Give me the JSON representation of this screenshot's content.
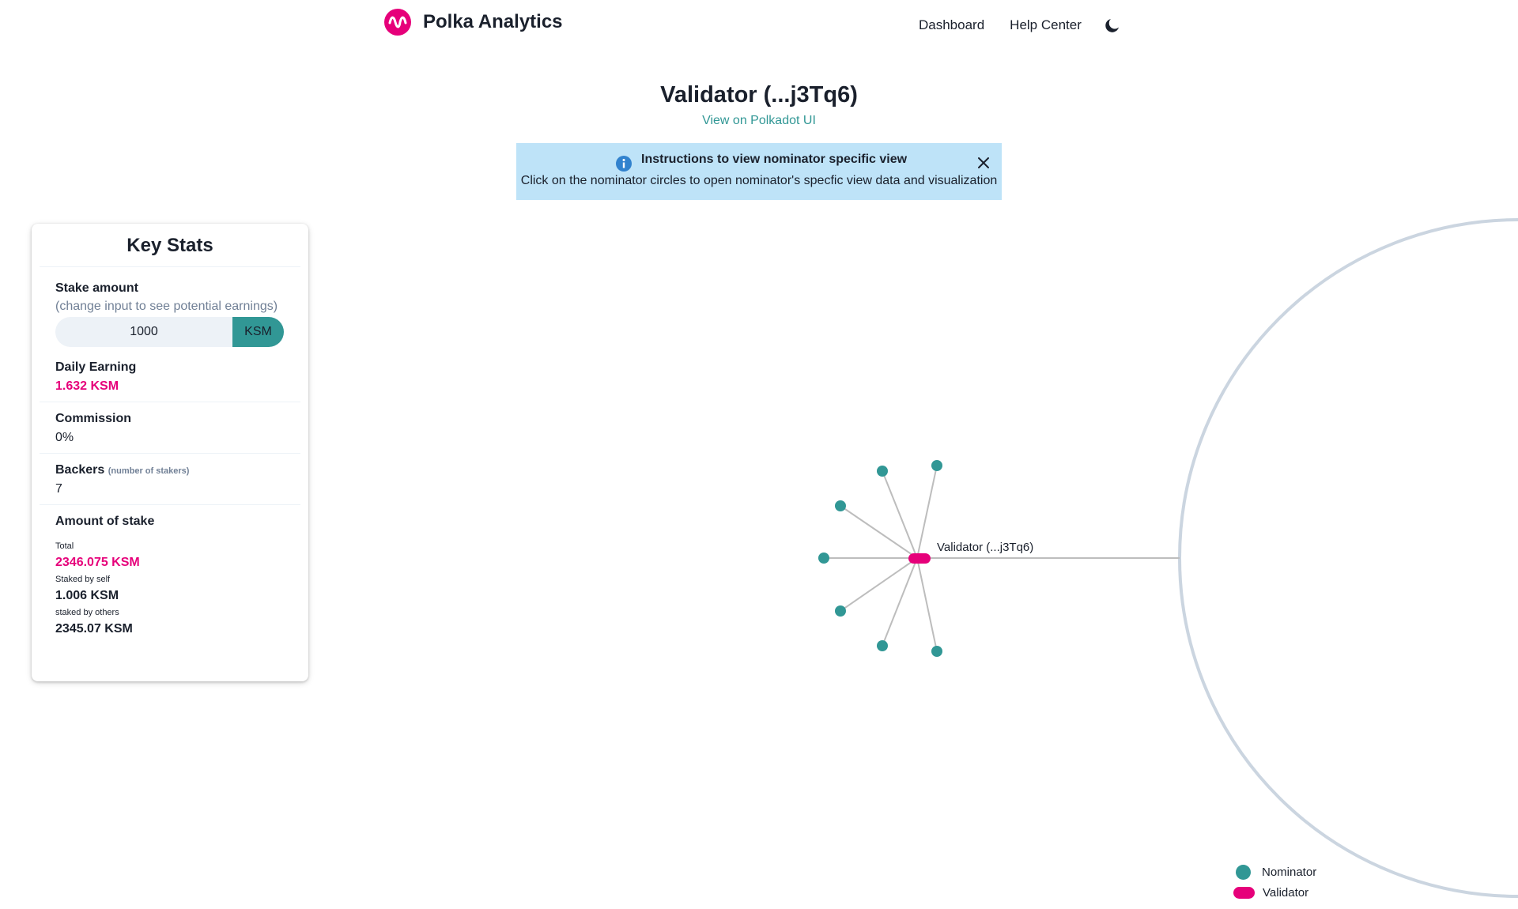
{
  "header": {
    "brand": "Polka Analytics",
    "nav": [
      "Dashboard",
      "Help Center"
    ],
    "theme_icon": "moon-icon"
  },
  "page": {
    "title": "Validator (...j3Tq6)",
    "link": "View on Polkadot UI"
  },
  "alert": {
    "title": "Instructions to view nominator specific view",
    "description": "Click on the nominator circles to open nominator's specfic view data and visualization",
    "icon": "info-icon",
    "color": "#bee3f8"
  },
  "key_stats": {
    "title": "Key Stats",
    "stake_amount": {
      "label": "Stake amount",
      "hint": "(change input to see potential earnings)",
      "value": "1000",
      "unit": "KSM"
    },
    "daily_earning": {
      "label": "Daily Earning",
      "value": "1.632 KSM"
    },
    "commission": {
      "label": "Commission",
      "value": "0%"
    },
    "backers": {
      "label": "Backers",
      "hint": "(number of stakers)",
      "value": "7"
    },
    "amount_of_stake": {
      "label": "Amount of stake",
      "total_label": "Total",
      "total_value": "2346.075 KSM",
      "self_label": "Staked by self",
      "self_value": "1.006 KSM",
      "others_label": "staked by others",
      "others_value": "2345.07 KSM"
    }
  },
  "graph": {
    "validator_label": "Validator (...j3Tq6)",
    "nominator_count": 8,
    "colors": {
      "nominator": "#319795",
      "validator": "#e6007a",
      "edge": "#bdbdbd",
      "ring": "#cbd5e0"
    }
  },
  "legend": {
    "nominator": "Nominator",
    "validator": "Validator"
  },
  "colors": {
    "brand": "#e6007a",
    "accent": "#319795"
  }
}
